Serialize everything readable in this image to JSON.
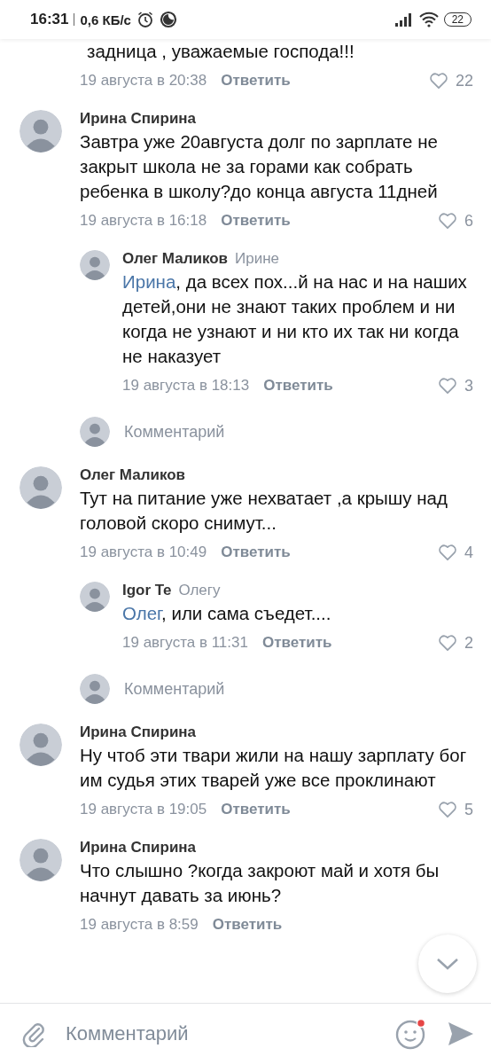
{
  "status_bar": {
    "time": "16:31",
    "speed": "0,6 КБ/с",
    "battery": "22"
  },
  "comments": [
    {
      "kind": "cut",
      "text": "задница , уважаемые господа!!!",
      "date": "19 августа в 20:38",
      "reply_label": "Ответить",
      "likes": "22"
    },
    {
      "kind": "comment",
      "author": "Ирина Спирина",
      "text": "Завтра уже 20августа долг по зарплате не закрыт школа не за горами как собрать ребенка в школу?до конца августа 11дней",
      "date": "19 августа в 16:18",
      "reply_label": "Ответить",
      "likes": "6"
    },
    {
      "kind": "reply",
      "author": "Олег Маликов",
      "reply_to": "Ирине",
      "mention": "Ирина",
      "text": ", да всех пох...й на нас и на наших детей,они не знают таких проблем и ни когда не узнают и ни кто их так ни когда не наказует",
      "date": "19 августа в 18:13",
      "reply_label": "Ответить",
      "likes": "3"
    },
    {
      "kind": "prompt",
      "placeholder": "Комментарий"
    },
    {
      "kind": "comment",
      "author": "Олег Маликов",
      "text": "Тут на питание уже нехватает ,а крышу над головой скоро снимут...",
      "date": "19 августа в 10:49",
      "reply_label": "Ответить",
      "likes": "4"
    },
    {
      "kind": "reply",
      "author": "Igor Te",
      "reply_to": "Олегу",
      "mention": "Олег",
      "text": ", или сама съедет....",
      "date": "19 августа в 11:31",
      "reply_label": "Ответить",
      "likes": "2"
    },
    {
      "kind": "prompt",
      "placeholder": "Комментарий"
    },
    {
      "kind": "comment",
      "author": "Ирина Спирина",
      "text": "Ну чтоб эти твари жили на нашу зарплату бог им судья этих тварей уже все проклинают",
      "date": "19 августа в 19:05",
      "reply_label": "Ответить",
      "likes": "5"
    },
    {
      "kind": "comment",
      "author": "Ирина Спирина",
      "text": "Что слышно ?когда закроют май и хотя бы начнут давать за июнь?",
      "date": "19 августа в 8:59",
      "reply_label": "Ответить"
    }
  ],
  "composer": {
    "placeholder": "Комментарий"
  }
}
